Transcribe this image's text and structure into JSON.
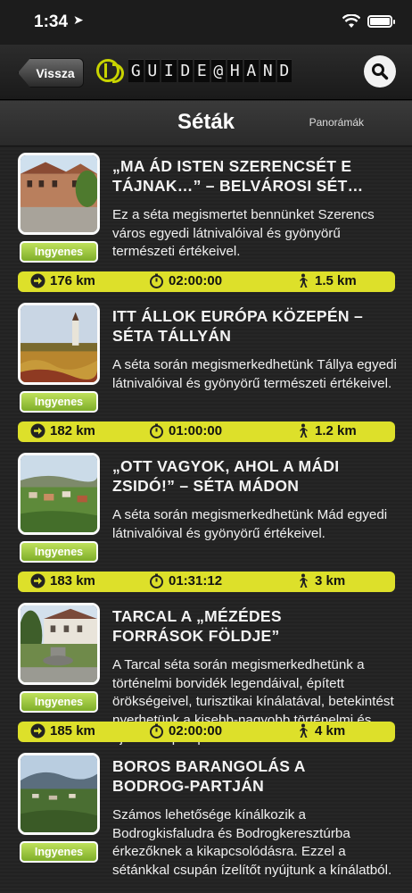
{
  "status": {
    "time": "1:34"
  },
  "nav": {
    "back_label": "Vissza",
    "brand_chars": [
      "G",
      "U",
      "I",
      "D",
      "E",
      "@",
      "H",
      "A",
      "N",
      "D"
    ]
  },
  "title_bar": {
    "title": "Séták",
    "panorama_label": "Panorámák"
  },
  "items": [
    {
      "title_line1": "„MA ÁD ISTEN SZERENCSÉT E",
      "title_line2": "TÁJNAK…” – BELVÁROSI SÉT…",
      "desc": "Ez a séta megismertet bennünket Szerencs város egyedi látnivalóival és gyönyörű természeti értékeivel.",
      "price": "Ingyenes",
      "distance": "176 km",
      "duration": "02:00:00",
      "walk": "1.5 km"
    },
    {
      "title_line1": "ITT ÁLLOK EURÓPA KÖZEPÉN –",
      "title_line2": "SÉTA TÁLLYÁN",
      "desc": "A séta során megismerkedhetünk Tállya egyedi látnivalóival és gyönyörű természeti értékeivel.",
      "price": "Ingyenes",
      "distance": "182 km",
      "duration": "01:00:00",
      "walk": "1.2 km"
    },
    {
      "title_line1": "„OTT VAGYOK, AHOL A MÁDI",
      "title_line2": "ZSIDÓ!” – SÉTA MÁDON",
      "desc": "A séta során megismerkedhetünk Mád egyedi látnivalóival és gyönyörű értékeivel.",
      "price": "Ingyenes",
      "distance": "183 km",
      "duration": "01:31:12",
      "walk": "3 km"
    },
    {
      "title_line1": "TARCAL A „MÉZÉDES",
      "title_line2": "FORRÁSOK FÖLDJE”",
      "desc": "A Tarcal séta során megismerkedhetünk a történelmi borvidék legendáival, épített örökségeivel, turisztikai kínálatával, betekintést nyerhetünk a kisebb-nagyobb történelmi és újonnan épült pincészete…",
      "price": "Ingyenes",
      "distance": "185 km",
      "duration": "02:00:00",
      "walk": "4 km"
    },
    {
      "title_line1": "BOROS BARANGOLÁS A",
      "title_line2": "BODROG-PARTJÁN",
      "desc": "Számos lehetősége kínálkozik a Bodrogkisfaludra és Bodrogkeresztúrba érkezőknek a kikapcsolódásra. Ezzel a sétánkkal csupán ízelítőt nyújtunk a kínálatból.",
      "price": "Ingyenes",
      "distance": "",
      "duration": "",
      "walk": ""
    }
  ]
}
